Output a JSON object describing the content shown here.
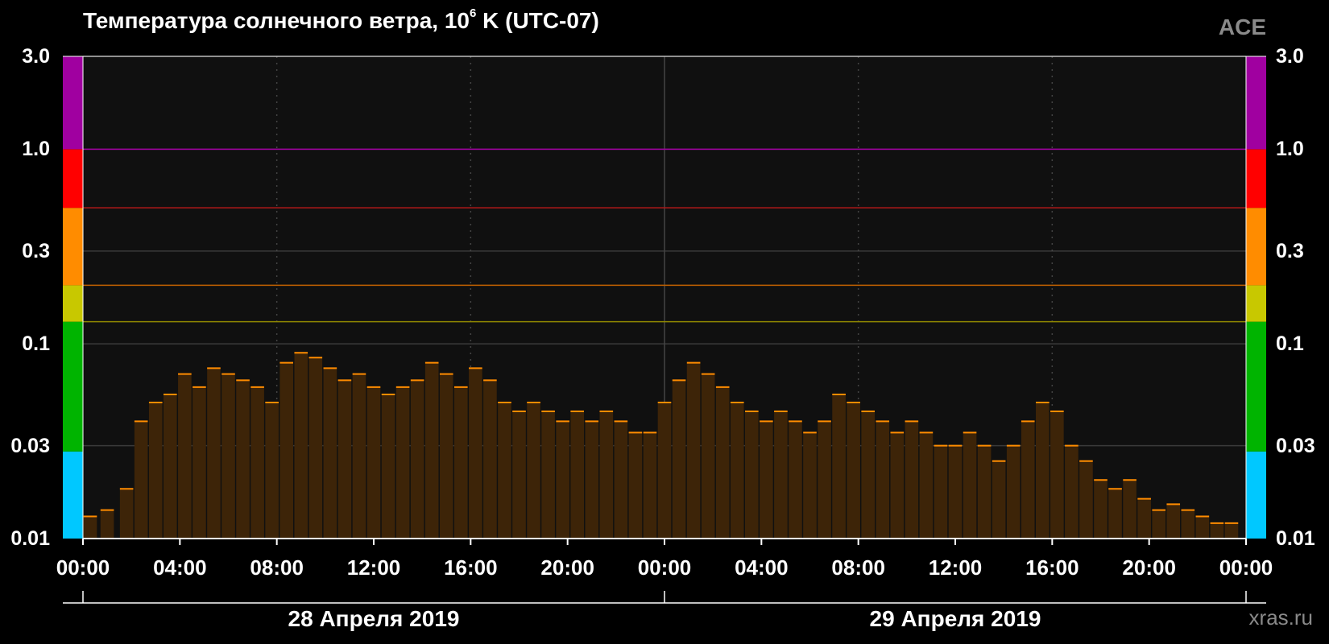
{
  "header": {
    "title_main": "Температура солнечного ветра, 10",
    "title_sup": "6",
    "title_tail": " K (UTC-07)",
    "source": "ACE",
    "website": "xras.ru"
  },
  "chart_data": {
    "type": "bar",
    "y_scale": "log",
    "ylim": [
      0.01,
      3.0
    ],
    "y_ticks": [
      "3.0",
      "1.0",
      "0.3",
      "0.1",
      "0.03",
      "0.01"
    ],
    "y_tick_values": [
      3.0,
      1.0,
      0.3,
      0.1,
      0.03,
      0.01
    ],
    "x_range_hours": [
      0,
      48
    ],
    "x_ticks": [
      "00:00",
      "04:00",
      "08:00",
      "12:00",
      "16:00",
      "20:00",
      "00:00",
      "04:00",
      "08:00",
      "12:00",
      "16:00",
      "20:00",
      "00:00"
    ],
    "date_labels": [
      "28 Апреля 2019",
      "29 Апреля 2019"
    ],
    "threshold_levels": [
      {
        "value": 1.0,
        "color": "#a000a0"
      },
      {
        "value": 0.5,
        "color": "#b01818"
      },
      {
        "value": 0.2,
        "color": "#c06000"
      },
      {
        "value": 0.13,
        "color": "#908800"
      }
    ],
    "scale_bands": [
      {
        "from": 0.01,
        "to": 0.028,
        "color": "#00c8ff"
      },
      {
        "from": 0.028,
        "to": 0.13,
        "color": "#00b400"
      },
      {
        "from": 0.13,
        "to": 0.2,
        "color": "#c8c800"
      },
      {
        "from": 0.2,
        "to": 0.5,
        "color": "#ff8c00"
      },
      {
        "from": 0.5,
        "to": 1.0,
        "color": "#ff0000"
      },
      {
        "from": 1.0,
        "to": 3.0,
        "color": "#a000a0"
      }
    ],
    "series": [
      {
        "color": "#ff8c00",
        "x_hours": [
          0.3,
          1.0,
          1.8,
          2.4,
          3.0,
          3.6,
          4.2,
          4.8,
          5.4,
          6.0,
          6.6,
          7.2,
          7.8,
          8.4,
          9.0,
          9.6,
          10.2,
          10.8,
          11.4,
          12.0,
          12.6,
          13.2,
          13.8,
          14.4,
          15.0,
          15.6,
          16.2,
          16.8,
          17.4,
          18.0,
          18.6,
          19.2,
          19.8,
          20.4,
          21.0,
          21.6,
          22.2,
          22.8,
          23.4,
          24.0,
          24.6,
          25.2,
          25.8,
          26.4,
          27.0,
          27.6,
          28.2,
          28.8,
          29.4,
          30.0,
          30.6,
          31.2,
          31.8,
          32.4,
          33.0,
          33.6,
          34.2,
          34.8,
          35.4,
          36.0,
          36.6,
          37.2,
          37.8,
          38.4,
          39.0,
          39.6,
          40.2,
          40.8,
          41.4,
          42.0,
          42.6,
          43.2,
          43.8,
          44.4,
          45.0,
          45.6,
          46.2,
          46.8,
          47.4
        ],
        "values": [
          0.013,
          0.014,
          0.018,
          0.04,
          0.05,
          0.055,
          0.07,
          0.06,
          0.075,
          0.07,
          0.065,
          0.06,
          0.05,
          0.08,
          0.09,
          0.085,
          0.075,
          0.065,
          0.07,
          0.06,
          0.055,
          0.06,
          0.065,
          0.08,
          0.07,
          0.06,
          0.075,
          0.065,
          0.05,
          0.045,
          0.05,
          0.045,
          0.04,
          0.045,
          0.04,
          0.045,
          0.04,
          0.035,
          0.035,
          0.05,
          0.065,
          0.08,
          0.07,
          0.06,
          0.05,
          0.045,
          0.04,
          0.045,
          0.04,
          0.035,
          0.04,
          0.055,
          0.05,
          0.045,
          0.04,
          0.035,
          0.04,
          0.035,
          0.03,
          0.03,
          0.035,
          0.03,
          0.025,
          0.03,
          0.04,
          0.05,
          0.045,
          0.03,
          0.025,
          0.02,
          0.018,
          0.02,
          0.016,
          0.014,
          0.015,
          0.014,
          0.013,
          0.012,
          0.012
        ]
      }
    ]
  }
}
